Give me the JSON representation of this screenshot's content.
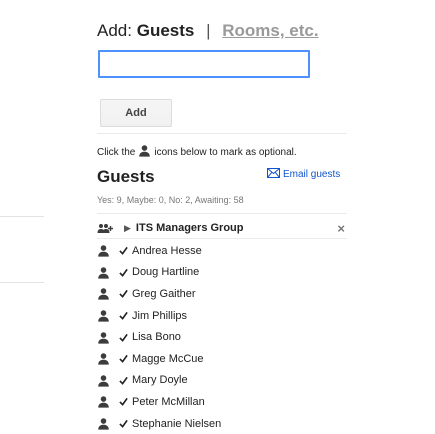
{
  "header": {
    "add_label": "Add:",
    "guests_tab": "Guests",
    "separator": "|",
    "rooms_tab": "Rooms, etc."
  },
  "input": {
    "value": "",
    "placeholder": ""
  },
  "add_button": "Add",
  "hint": {
    "before": "Click the",
    "after": "icons below to mark as optional."
  },
  "guests": {
    "title": "Guests",
    "email_label": "Email guests",
    "rsvp_summary": "Yes: 9, Maybe: 0, No: 2, Awaiting: 58"
  },
  "group": {
    "name": "ITS Managers Group",
    "remove": "×"
  },
  "guest_list": [
    "Andrea Hesse",
    "Doug Hartline",
    "Greg Gaither",
    "Jim Phillips",
    "Lisa Bono",
    "Magge McCue",
    "Mary Doyle",
    "Peter McMillan",
    "Stephanie Nielsen"
  ],
  "icons": {
    "person": "person-icon",
    "group": "group-icon",
    "check": "check-icon",
    "envelope": "envelope-icon",
    "chevron": "chevron-right-icon",
    "remove": "close-icon"
  }
}
